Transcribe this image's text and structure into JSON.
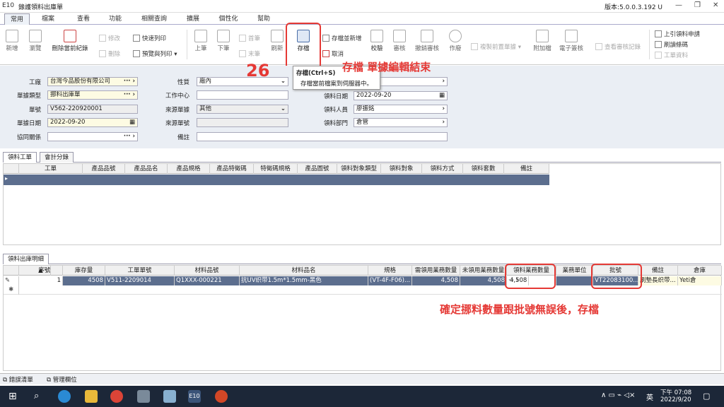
{
  "window": {
    "logo": "E10",
    "title": "錄護領料出庫單",
    "version": "版本:5.0.0.3.192 U"
  },
  "menu": [
    "常用",
    "檔案",
    "查看",
    "功能",
    "相關查詢",
    "擴展",
    "個性化",
    "幫助"
  ],
  "ribbon": {
    "new": "新增",
    "browse": "瀏覽",
    "delete_current": "刪除當前紀錄",
    "modify": "修改",
    "delete": "刪除",
    "quick_print": "快速列印",
    "preview_print": "預覽與列印",
    "prev": "上筆",
    "next": "下筆",
    "first": "首筆",
    "last": "末筆",
    "refresh": "刷新",
    "save": "存檔",
    "save_new": "存檔並新增",
    "cancel": "取消",
    "check": "校驗",
    "audit": "審核",
    "unaudit": "撤銷審核",
    "void": "作廢",
    "copy_prev": "複製前置單據",
    "attach": "附加檔",
    "esign": "電子簽核",
    "view_audit": "查看審核記錄",
    "upper": "上引領料申請",
    "refresh_code": "刷讀條碼",
    "work_data": "工單資料"
  },
  "dropdown": {
    "title": "存檔(Ctrl+S)",
    "desc": "存檔當前檔案到伺服器中。"
  },
  "annotation": {
    "step": "26",
    "save_note": "存檔 單據編輯結束",
    "bottom_note": "確定挪料數量跟批號無誤後，存檔"
  },
  "form": {
    "factory_label": "工廠",
    "factory": "台灣今品股份有限公司",
    "doc_type_label": "單據類型",
    "doc_type": "挪料出庫單",
    "doc_no_label": "單號",
    "doc_no": "V562-220920001",
    "doc_date_label": "單據日期",
    "doc_date": "2022-09-20",
    "assoc_label": "協同關係",
    "nature_label": "性質",
    "nature": "廠內",
    "work_center_label": "工作中心",
    "source_type_label": "來源單據",
    "source_type": "其他",
    "source_no_label": "來源單號",
    "remark_label": "備註",
    "pick_date_label": "領料日期",
    "pick_date": "2022-09-20",
    "picker_label": "領料人員",
    "picker": "廖振銘",
    "dept_label": "領料部門",
    "dept": "倉管"
  },
  "tabs_top": [
    "領料工單",
    "會計分錄"
  ],
  "grid1_headers": [
    "工單",
    "產品品號",
    "產品品名",
    "產品規格",
    "產品特徵碼",
    "特徵碼規格",
    "產品圖號",
    "領料對象類型",
    "領料對象",
    "領料方式",
    "領料套數",
    "備註"
  ],
  "tab_bottom": "領料出庫明細",
  "grid2_headers": [
    "序號",
    "庫存量",
    "工單單號",
    "材料品號",
    "材料品名",
    "規格",
    "需領用業務數量",
    "未領用業務數量",
    "領料業務數量",
    "業務單位",
    "批號",
    "備註",
    "倉庫"
  ],
  "grid2_row": [
    "1",
    "4508",
    "V511-2209014",
    "Q1XXX-000221",
    "抗UV织带1.5m*1.5mm-黑色",
    "(VT-4F-F06)...",
    "4,508",
    "4,508",
    "4,508",
    "",
    "VT22083100...",
    "刷墊長织带...",
    "Yeti倉"
  ],
  "status_tabs": [
    "錯誤清單",
    "管理欄位"
  ],
  "taskbar": {
    "time": "下午 07:08",
    "date": "2022/9/20",
    "lang": "英"
  }
}
